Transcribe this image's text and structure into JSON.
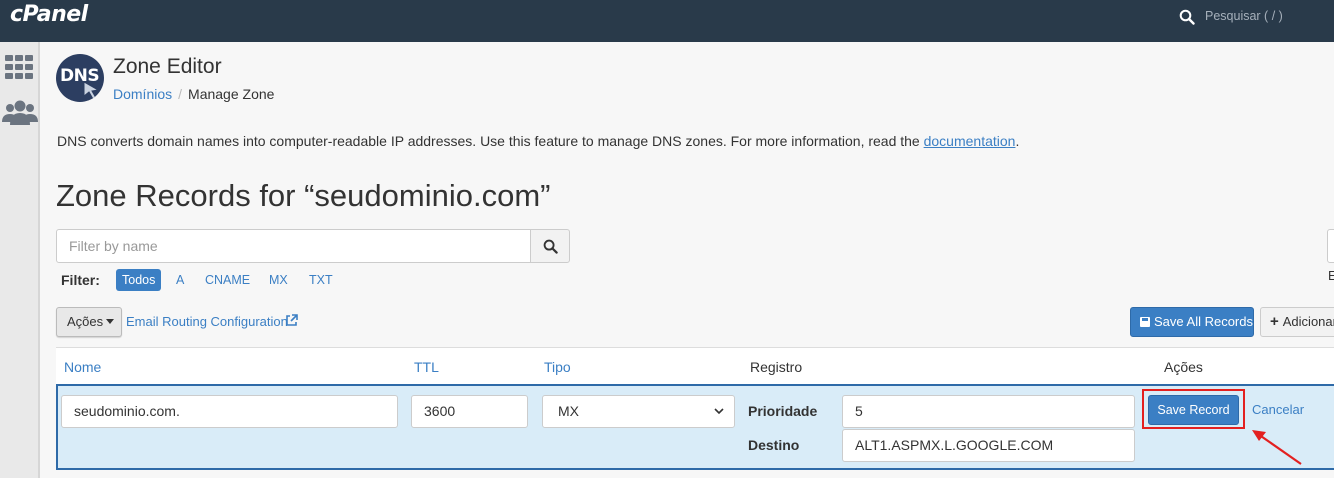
{
  "topbar": {
    "logo": "cPanel",
    "search_label": "Pesquisar ( / )"
  },
  "header": {
    "logo_text": "DNS",
    "title": "Zone Editor",
    "breadcrumb_link": "Domínios",
    "breadcrumb_separator": "/",
    "breadcrumb_current": "Manage Zone"
  },
  "description": {
    "text": "DNS converts domain names into computer-readable IP addresses. Use this feature to manage DNS zones. For more information, read the ",
    "link": "documentation",
    "suffix": "."
  },
  "zone_title": "Zone Records for “seudominio.com”",
  "filter": {
    "placeholder": "Filter by name",
    "label": "Filter:",
    "chips": [
      "Todos",
      "A",
      "CNAME",
      "MX",
      "TXT"
    ],
    "active_chip": "Todos",
    "right_edge_text": "E"
  },
  "actions": {
    "acoes_label": "Ações",
    "email_routing": "Email Routing Configuration",
    "save_all": "Save All Records",
    "adicionar": "Adicionar"
  },
  "table": {
    "columns": {
      "nome": "Nome",
      "ttl": "TTL",
      "tipo": "Tipo",
      "registro": "Registro",
      "acoes": "Ações"
    },
    "edit_row": {
      "name": "seudominio.com.",
      "ttl": "3600",
      "type": "MX",
      "priority_label": "Prioridade",
      "priority": "5",
      "destination_label": "Destino",
      "destination": "ALT1.ASPMX.L.GOOGLE.COM",
      "save_record": "Save Record",
      "cancel": "Cancelar"
    }
  },
  "colors": {
    "topbar": "#293a4a",
    "accent": "#3b7fc4",
    "row_highlight": "#d9ecf8",
    "annotation_red": "#e32020"
  },
  "icons": [
    "search-icon",
    "grid-icon",
    "users-icon",
    "dns-logo",
    "external-link-icon",
    "save-disk-icon",
    "plus-icon",
    "chevron-down-icon",
    "red-arrow-annotation"
  ]
}
